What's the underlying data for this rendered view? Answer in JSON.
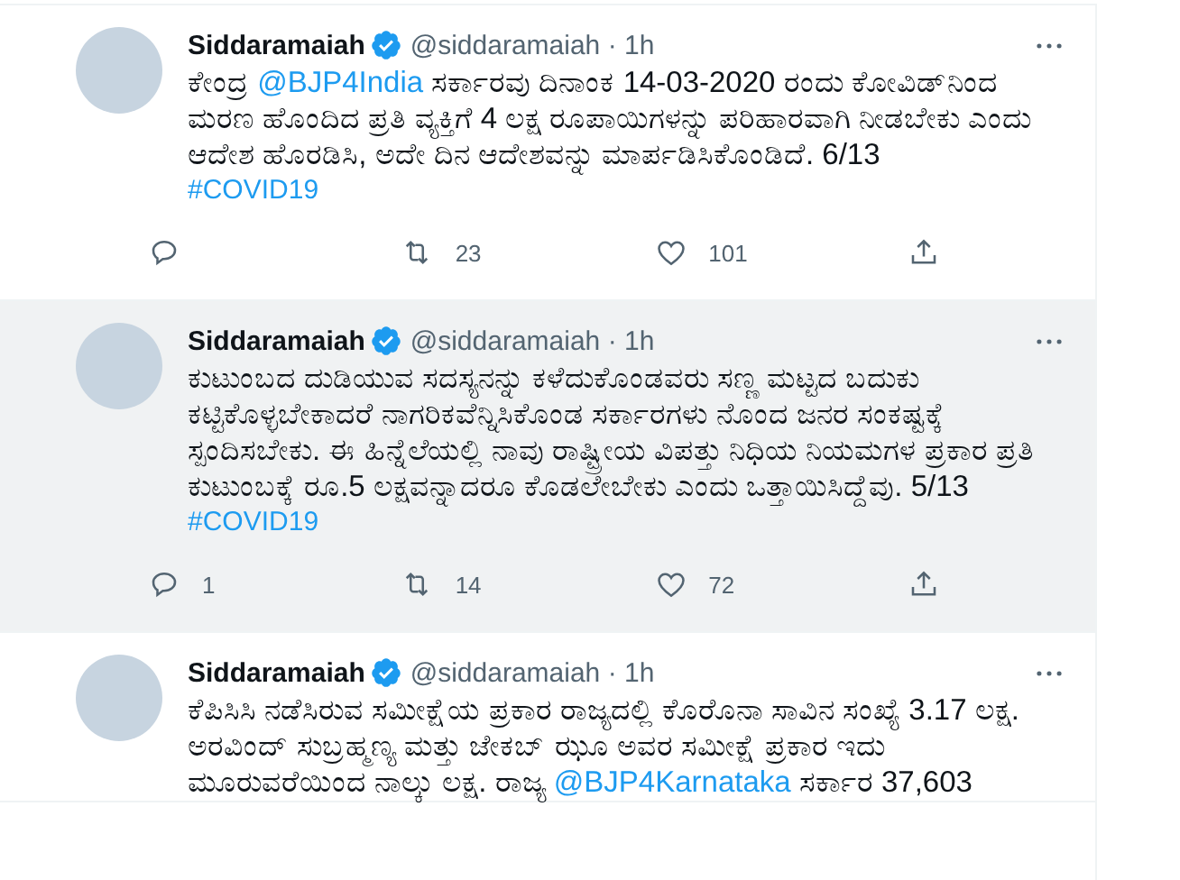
{
  "tweets": [
    {
      "name": "Siddaramaiah",
      "verified": true,
      "meta": "@siddaramaiah · 1h",
      "hovered": false,
      "text": "ಕೇಂದ್ರ @BJP4India ಸರ್ಕಾರವು ದಿನಾಂಕ 14-03-2020 ರಂದು ಕೋವಿಡ್‌ನಿಂದ ಮರಣ ಹೊಂದಿದ ಪ್ರತಿ ವ್ಯಕ್ತಿಗೆ 4 ಲಕ್ಷ ರೂಪಾಯಿಗಳನ್ನು ಪರಿಹಾರವಾಗಿ ನೀಡಬೇಕು ಎಂದು ಆದೇಶ ಹೊರಡಿಸಿ, ಅದೇ ದಿನ ಆದೇಶವನ್ನು ಮಾರ್ಪಡಿಸಿಕೊಂಡಿದೆ. 6/13",
      "hashtag": "#COVID19",
      "retweets": "23",
      "likes": "101"
    },
    {
      "name": "Siddaramaiah",
      "verified": true,
      "meta": "@siddaramaiah · 1h",
      "hovered": true,
      "text": "ಕುಟುಂಬದ ದುಡಿಯುವ ಸದಸ್ಯನನ್ನು ಕಳೆದುಕೊಂಡವರು ಸಣ್ಣ ಮಟ್ಟದ ಬದುಕು ಕಟ್ಟಿಕೊಳ್ಳಬೇಕಾದರೆ ನಾಗರಿಕವೆನ್ನಿಸಿಕೊಂಡ ಸರ್ಕಾರಗಳು ನೊಂದ ಜನರ ಸಂಕಷ್ಟಕ್ಕೆ ಸ್ಪಂದಿಸಬೇಕು. ಈ ಹಿನ್ನೆಲೆಯಲ್ಲಿ ನಾವು ರಾಷ್ಟ್ರೀಯ ವಿಪತ್ತು ನಿಧಿಯ ನಿಯಮಗಳ ಪ್ರಕಾರ ಪ್ರತಿ ಕುಟುಂಬಕ್ಕೆ ರೂ.5 ಲಕ್ಷವನ್ನಾದರೂ ಕೊಡಲೇಬೇಕು ಎಂದು ಒತ್ತಾಯಿಸಿದ್ದೆವು. 5/13",
      "hashtag": "#COVID19",
      "replies": "1",
      "retweets": "14",
      "likes": "72"
    },
    {
      "name": "Siddaramaiah",
      "verified": true,
      "meta": "@siddaramaiah · 1h",
      "hovered": false,
      "text": "ಕೆಪಿಸಿಸಿ ನಡೆಸಿರುವ ಸಮೀಕ್ಷೆಯ ಪ್ರಕಾರ ರಾಜ್ಯದಲ್ಲಿ ಕೊರೊನಾ ಸಾವಿನ ಸಂಖ್ಯೆ 3.17 ಲಕ್ಷ.  ಅರವಿಂದ್ ಸುಬ್ರಹ್ಮಣ್ಯ ಮತ್ತು ಜೇಕಬ್ ಝೂ ಅವರ ಸಮೀಕ್ಷೆ ಪ್ರಕಾರ ಇದು ಮೂರುವರೆಯಿಂದ ನಾಲ್ಕು ಲಕ್ಷ. ರಾಜ್ಯ @BJP4Karnataka ಸರ್ಕಾರ 37,603"
    }
  ]
}
